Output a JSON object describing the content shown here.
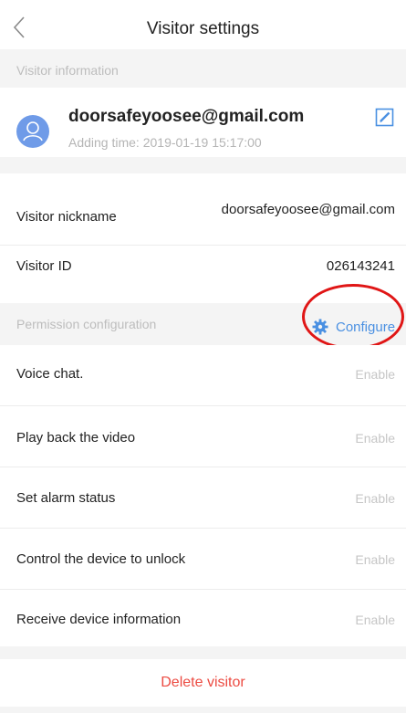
{
  "header": {
    "title": "Visitor settings"
  },
  "visitor_info": {
    "section_label": "Visitor information",
    "email": "doorsafeyoosee@gmail.com",
    "added_time": "Adding time: 2019-01-19 15:17:00"
  },
  "details": {
    "nickname_label": "Visitor nickname",
    "nickname_value": "doorsafeyoosee@gmail.com",
    "id_label": "Visitor ID",
    "id_value": "026143241"
  },
  "permissions": {
    "section_label": "Permission configuration",
    "configure_label": "Configure",
    "items": [
      {
        "label": "Voice chat.",
        "value": "Enable"
      },
      {
        "label": "Play back the video",
        "value": "Enable"
      },
      {
        "label": "Set alarm status",
        "value": "Enable"
      },
      {
        "label": "Control the device to unlock",
        "value": "Enable"
      },
      {
        "label": "Receive device information",
        "value": "Enable"
      }
    ]
  },
  "actions": {
    "delete_label": "Delete visitor"
  },
  "colors": {
    "accent": "#4a90e2",
    "danger": "#ec4b42",
    "annotation": "#e01616"
  }
}
